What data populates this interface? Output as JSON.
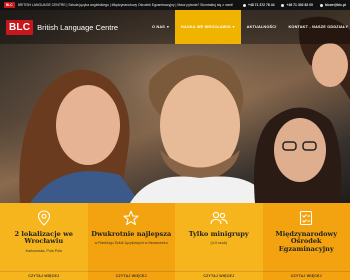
{
  "topbar": {
    "logo": "BLC",
    "tagline": "BRITISH LANGUAGE CENTRE | Szkoła języka angielskiego | Międzynarodowy Ośrodek Egzaminacyjny | Masz pytania? Skontaktuj się z nami!",
    "phone1": "+48 71 372 78 44",
    "phone2": "+48 71 302 82 00",
    "email": "blcwr@blc.pl"
  },
  "header": {
    "logo": "BLC",
    "brand_name": "British Language Centre"
  },
  "nav": {
    "items": [
      {
        "label": "O NAS",
        "dropdown": true,
        "active": false
      },
      {
        "label": "NAUKA WE WROCŁAWIU",
        "dropdown": true,
        "active": true
      },
      {
        "label": "AKTUALNOŚCI",
        "dropdown": false,
        "active": false
      },
      {
        "label": "KONTAKT - NASZE ODDZIAŁY",
        "dropdown": false,
        "active": false
      }
    ]
  },
  "features": [
    {
      "icon": "location-pin-icon",
      "title": "2 lokalizacje we Wrocławiu",
      "desc": "Karkonoska, Pola Pola",
      "more": "CZYTAJ WIĘCEJ"
    },
    {
      "icon": "star-icon",
      "title": "Dwukrotnie najlepsza",
      "desc": "w Rankingu Szkół Językowych w Newsweeku",
      "more": "CZYTAJ WIĘCEJ"
    },
    {
      "icon": "people-icon",
      "title": "Tylko minigrupy",
      "desc": "(4-9 osób)",
      "more": "CZYTAJ WIĘCEJ"
    },
    {
      "icon": "checklist-icon",
      "title": "Międzynarodowy Ośrodek Egzaminacyjny",
      "desc": "",
      "more": "CZYTAJ WIĘCEJ"
    }
  ],
  "colors": {
    "brand_red": "#c8161d",
    "accent_yellow": "#f6b51c",
    "accent_orange": "#f2a30f"
  }
}
